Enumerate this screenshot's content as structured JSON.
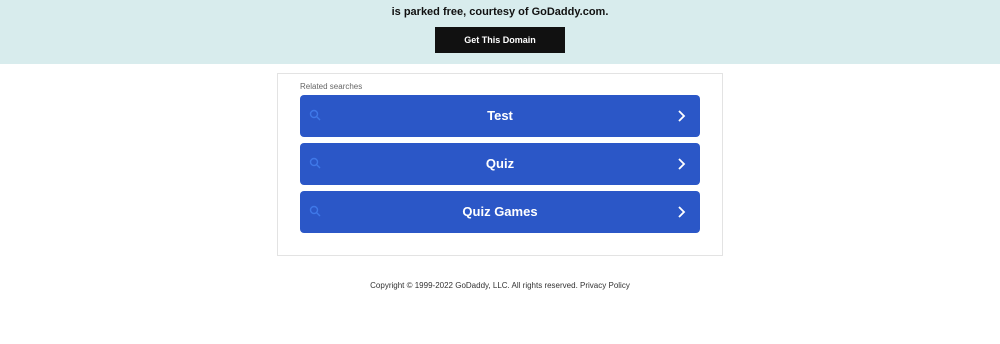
{
  "banner": {
    "text": "is parked free, courtesy of GoDaddy.com.",
    "cta_label": "Get This Domain"
  },
  "related": {
    "heading": "Related searches",
    "items": [
      {
        "label": "Test",
        "icon": "search-icon",
        "chevron": "chevron-right-icon"
      },
      {
        "label": "Quiz",
        "icon": "search-icon",
        "chevron": "chevron-right-icon"
      },
      {
        "label": "Quiz Games",
        "icon": "search-icon",
        "chevron": "chevron-right-icon"
      }
    ]
  },
  "footer": {
    "copyright": "Copyright © 1999-2022 GoDaddy, LLC. All rights reserved.",
    "privacy_label": "Privacy Policy"
  },
  "colors": {
    "banner_bg": "#d8eced",
    "cta_bg": "#111111",
    "button_bg": "#2b57c7"
  }
}
